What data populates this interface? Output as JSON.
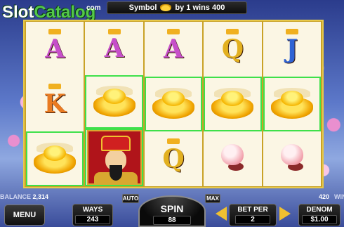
{
  "logo": {
    "part1": "Slot",
    "part2": "Catalog",
    "suffix": "com"
  },
  "message": {
    "prefix": "Symbol",
    "suffix": "by 1 wins 400"
  },
  "reels": [
    [
      {
        "symbol": "A",
        "win": false
      },
      {
        "symbol": "K",
        "win": false
      },
      {
        "symbol": "ingot",
        "win": true
      }
    ],
    [
      {
        "symbol": "A",
        "win": false
      },
      {
        "symbol": "ingot",
        "win": true
      },
      {
        "symbol": "god",
        "win": true
      }
    ],
    [
      {
        "symbol": "A",
        "win": false
      },
      {
        "symbol": "ingot",
        "win": true
      },
      {
        "symbol": "Q",
        "win": false
      }
    ],
    [
      {
        "symbol": "Q",
        "win": false
      },
      {
        "symbol": "ingot",
        "win": true
      },
      {
        "symbol": "peach",
        "win": false
      }
    ],
    [
      {
        "symbol": "J",
        "win": false
      },
      {
        "symbol": "ingot",
        "win": true
      },
      {
        "symbol": "peach",
        "win": false
      }
    ]
  ],
  "balance": {
    "label": "BALANCE",
    "value": "2,314"
  },
  "win": {
    "value": "420",
    "label": "WIN"
  },
  "buttons": {
    "menu": "MENU",
    "auto": "AUTO",
    "max": "MAX",
    "ways_label": "WAYS",
    "ways_value": "243",
    "spin_label": "SPIN",
    "spin_value": "88",
    "betper_label": "BET PER",
    "betper_value": "2",
    "denom_label": "DENOM",
    "denom_value": "$1.00"
  },
  "colors": {
    "win_border": "#3ee04a",
    "reel_frame": "#c9a227",
    "arrow": "#f0c030"
  }
}
